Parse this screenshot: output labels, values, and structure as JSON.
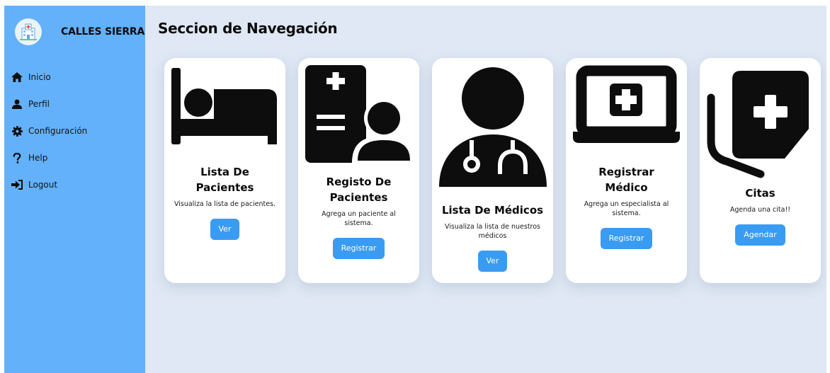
{
  "brand": {
    "name": "CALLES SIERRA",
    "logo_icon": "hospital-building-icon"
  },
  "nav": [
    {
      "label": "Inicio",
      "icon": "home-icon"
    },
    {
      "label": "Perfil",
      "icon": "user-icon"
    },
    {
      "label": "Configuración",
      "icon": "gear-icon"
    },
    {
      "label": "Help",
      "icon": "question-icon"
    },
    {
      "label": "Logout",
      "icon": "logout-icon"
    }
  ],
  "main": {
    "title": "Seccion de Navegación",
    "cards": [
      {
        "icon": "bed-icon",
        "title": "Lista De Pacientes",
        "description": "Visualiza la lista de pacientes.",
        "button": "Ver"
      },
      {
        "icon": "patient-registration-icon",
        "title": "Registo De Pacientes",
        "description": "Agrega un paciente al sistema.",
        "button": "Registrar"
      },
      {
        "icon": "doctor-icon",
        "title": "Lista De Médicos",
        "description": "Visualiza la lista de nuestros médicos",
        "button": "Ver"
      },
      {
        "icon": "medical-laptop-icon",
        "title": "Registrar Médico",
        "description": "Agrega un especialista al sistema.",
        "button": "Registrar"
      },
      {
        "icon": "medical-notes-icon",
        "title": "Citas",
        "description": "Agenda una cita!!",
        "button": "Agendar"
      }
    ]
  },
  "colors": {
    "sidebar": "#63b1fb",
    "main_bg": "#dfe8f4",
    "button": "#3a9bf2",
    "icon": "#0d0d0d"
  }
}
